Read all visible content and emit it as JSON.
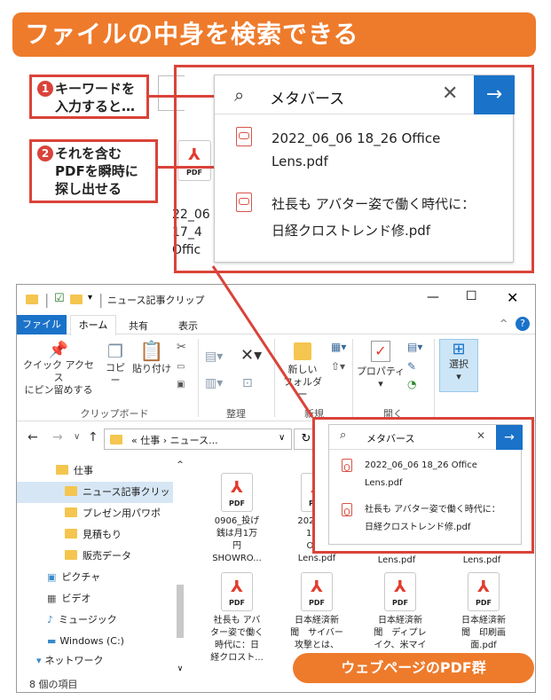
{
  "banner": {
    "title": "ファイルの中身を検索できる"
  },
  "callouts": {
    "c1": {
      "num": "1",
      "line1": "キーワードを",
      "line2": "入力すると…"
    },
    "c2": {
      "num": "2",
      "line1": "それを含む",
      "line2": "PDFを瞬時に",
      "line3": "探し出せる"
    }
  },
  "zoom_search": {
    "query": "メタバース",
    "results": [
      {
        "line1": "2022_06_06 18_26 Office",
        "line2": "Lens.pdf"
      },
      {
        "line1": "社長も アバター姿で働く時代に：",
        "line2": "日経クロストレンド修.pdf"
      }
    ]
  },
  "bg_file": {
    "pdf_label": "PDF",
    "l1": "22_06",
    "l2": "17_4",
    "l3": "Offic"
  },
  "window": {
    "title": "ニュース記事クリップ",
    "tabs": [
      "ファイル",
      "ホーム",
      "共有",
      "表示"
    ],
    "ribbon": {
      "quick_access_l1": "クイック アクセス",
      "quick_access_l2": "にピン留めする",
      "copy": "コピー",
      "paste": "貼り付け",
      "group_clipboard": "クリップボード",
      "group_organize": "整理",
      "new_folder_l1": "新しい",
      "new_folder_l2": "フォルダー",
      "group_new": "新規",
      "properties": "プロパティ",
      "group_open": "開く",
      "select": "選択"
    },
    "address": {
      "prefix": "«",
      "part1": "仕事",
      "sep": "›",
      "part2": "ニュース..."
    },
    "search": {
      "query": "メタバース"
    },
    "search_results": [
      {
        "line1": "2022_06_06 18_26 Office",
        "line2": "Lens.pdf"
      },
      {
        "line1": "社長も アバター姿で働く時代に：",
        "line2": "日経クロストレンド修.pdf"
      }
    ],
    "nav": [
      "仕事",
      "ニュース記事クリップ",
      "プレゼン用パワポ",
      "見積もり",
      "販売データ",
      "ピクチャ",
      "ビデオ",
      "ミュージック",
      "Windows (C:)",
      "ネットワーク"
    ],
    "files": [
      {
        "l1": "0906_投げ",
        "l2": "銭は月1万",
        "l3": "円",
        "l4": "SHOWRO..."
      },
      {
        "l1": "2022_06",
        "l2": "17_4",
        "l3": "Offic",
        "l4": "Lens.pdf"
      },
      {
        "l1": "Lens.pdf"
      },
      {
        "l1": "Lens.pdf"
      },
      {
        "l1": "社長も アバ",
        "l2": "ター姿で働く",
        "l3": "時代に：日",
        "l4": "経クロスト..."
      },
      {
        "l1": "日本経済新",
        "l2": "聞　サイバー",
        "l3": "攻撃とは、"
      },
      {
        "l1": "日本経済新",
        "l2": "聞　ディプレ",
        "l3": "イク、米マイ"
      },
      {
        "l1": "日本経済新",
        "l2": "聞　印刷画",
        "l3": "面.pdf"
      }
    ],
    "pdf_label": "PDF",
    "status": "8 個の項目"
  },
  "tag": {
    "text": "ウェブページのPDF群"
  },
  "colors": {
    "accent": "#ee7a2b",
    "red": "#d9433a",
    "blue": "#1a73c9"
  }
}
